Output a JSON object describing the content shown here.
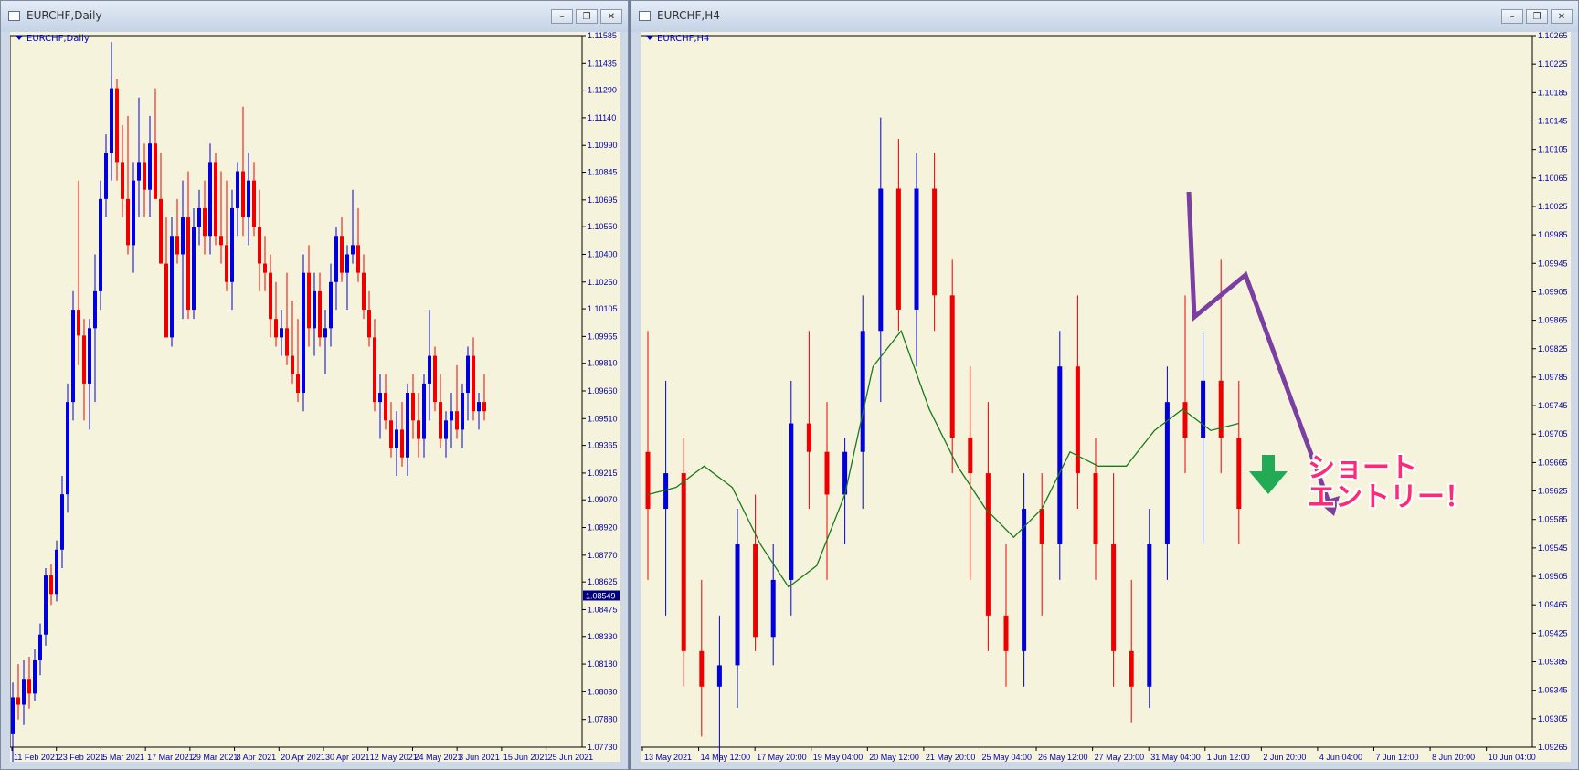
{
  "windows": [
    {
      "title": "EURCHF,Daily",
      "chart_label": "EURCHF,Daily",
      "buttons": [
        "minimize",
        "restore",
        "close"
      ]
    },
    {
      "title": "EURCHF,H4",
      "chart_label": "EURCHF,H4",
      "buttons": [
        "minimize",
        "restore",
        "close"
      ]
    }
  ],
  "annotation": {
    "line1": "ショート",
    "line2": "エントリー！"
  },
  "colors": {
    "bull": "#0000dd",
    "bear": "#ee0000",
    "ma": "#1a7a1a",
    "arrow_purple": "#7a3fa0",
    "arrow_green": "#22aa55",
    "annotation": "#ff2a75"
  },
  "chart_data": [
    {
      "type": "candlestick",
      "symbol": "EURCHF",
      "timeframe": "Daily",
      "y_ticks": [
        "1.11585",
        "1.11435",
        "1.11290",
        "1.11140",
        "1.10990",
        "1.10845",
        "1.10695",
        "1.10550",
        "1.10400",
        "1.10250",
        "1.10105",
        "1.09955",
        "1.09810",
        "1.09660",
        "1.09510",
        "1.09365",
        "1.09215",
        "1.09070",
        "1.08920",
        "1.08770",
        "1.08625",
        "1.08475",
        "1.08330",
        "1.08180",
        "1.08030",
        "1.07880",
        "1.07730"
      ],
      "ylim": [
        1.0773,
        1.11585
      ],
      "current_price": "1.08549",
      "x_labels": [
        "11 Feb 2021",
        "23 Feb 2021",
        "5 Mar 2021",
        "17 Mar 2021",
        "29 Mar 2021",
        "8 Apr 2021",
        "20 Apr 2021",
        "30 Apr 2021",
        "12 May 2021",
        "24 May 2021",
        "3 Jun 2021",
        "15 Jun 2021",
        "25 Jun 2021"
      ],
      "candles": [
        [
          1.078,
          1.0808,
          1.076,
          1.08
        ],
        [
          1.08,
          1.0818,
          1.0788,
          1.0796
        ],
        [
          1.0796,
          1.082,
          1.0785,
          1.081
        ],
        [
          1.081,
          1.0822,
          1.0794,
          1.0802
        ],
        [
          1.0802,
          1.0826,
          1.0798,
          1.082
        ],
        [
          1.082,
          1.084,
          1.0812,
          1.0834
        ],
        [
          1.0834,
          1.087,
          1.0828,
          1.0866
        ],
        [
          1.0866,
          1.0872,
          1.085,
          1.0856
        ],
        [
          1.0856,
          1.0885,
          1.0852,
          1.088
        ],
        [
          1.088,
          1.092,
          1.087,
          1.091
        ],
        [
          1.091,
          1.097,
          1.09,
          1.096
        ],
        [
          1.096,
          1.102,
          1.095,
          1.101
        ],
        [
          1.101,
          1.108,
          1.098,
          1.0996
        ],
        [
          1.0996,
          1.1005,
          1.095,
          1.097
        ],
        [
          1.097,
          1.1005,
          1.0945,
          1.1
        ],
        [
          1.1,
          1.104,
          1.096,
          1.102
        ],
        [
          1.102,
          1.108,
          1.101,
          1.107
        ],
        [
          1.107,
          1.1105,
          1.106,
          1.1095
        ],
        [
          1.1095,
          1.1155,
          1.108,
          1.113
        ],
        [
          1.113,
          1.1135,
          1.108,
          1.109
        ],
        [
          1.109,
          1.111,
          1.106,
          1.107
        ],
        [
          1.107,
          1.1115,
          1.104,
          1.1045
        ],
        [
          1.1045,
          1.109,
          1.103,
          1.108
        ],
        [
          1.108,
          1.1125,
          1.106,
          1.109
        ],
        [
          1.109,
          1.11,
          1.106,
          1.1075
        ],
        [
          1.1075,
          1.1115,
          1.106,
          1.11
        ],
        [
          1.11,
          1.113,
          1.107,
          1.107
        ],
        [
          1.107,
          1.1095,
          1.1035,
          1.1035
        ],
        [
          1.1035,
          1.106,
          1.0995,
          1.0995
        ],
        [
          1.0995,
          1.106,
          1.099,
          1.105
        ],
        [
          1.105,
          1.107,
          1.1035,
          1.104
        ],
        [
          1.104,
          1.108,
          1.1005,
          1.106
        ],
        [
          1.106,
          1.1085,
          1.1005,
          1.101
        ],
        [
          1.101,
          1.1065,
          1.1005,
          1.1055
        ],
        [
          1.1055,
          1.1075,
          1.1045,
          1.1065
        ],
        [
          1.1065,
          1.108,
          1.104,
          1.105
        ],
        [
          1.105,
          1.11,
          1.104,
          1.109
        ],
        [
          1.109,
          1.1095,
          1.1045,
          1.105
        ],
        [
          1.105,
          1.1085,
          1.1035,
          1.1045
        ],
        [
          1.1045,
          1.108,
          1.102,
          1.1025
        ],
        [
          1.1025,
          1.1075,
          1.101,
          1.1065
        ],
        [
          1.1065,
          1.109,
          1.105,
          1.1085
        ],
        [
          1.1085,
          1.112,
          1.105,
          1.106
        ],
        [
          1.106,
          1.1095,
          1.1045,
          1.108
        ],
        [
          1.108,
          1.109,
          1.105,
          1.1055
        ],
        [
          1.1055,
          1.1075,
          1.102,
          1.1035
        ],
        [
          1.1035,
          1.105,
          1.102,
          1.103
        ],
        [
          1.103,
          1.104,
          1.0995,
          1.1005
        ],
        [
          1.1005,
          1.1025,
          1.099,
          1.0995
        ],
        [
          1.0995,
          1.101,
          1.0985,
          1.1
        ],
        [
          1.1,
          1.103,
          1.098,
          1.0985
        ],
        [
          1.0985,
          1.1015,
          1.097,
          1.0975
        ],
        [
          1.0975,
          1.1005,
          1.096,
          1.0965
        ],
        [
          1.0965,
          1.104,
          1.0955,
          1.103
        ],
        [
          1.103,
          1.1045,
          1.099,
          1.1
        ],
        [
          1.1,
          1.103,
          1.0985,
          1.102
        ],
        [
          1.102,
          1.103,
          1.099,
          1.0995
        ],
        [
          1.0995,
          1.101,
          1.0975,
          1.1
        ],
        [
          1.1,
          1.1035,
          1.099,
          1.1025
        ],
        [
          1.1025,
          1.1055,
          1.101,
          1.105
        ],
        [
          1.105,
          1.106,
          1.1025,
          1.103
        ],
        [
          1.103,
          1.1045,
          1.101,
          1.104
        ],
        [
          1.104,
          1.1075,
          1.1035,
          1.1045
        ],
        [
          1.1045,
          1.1065,
          1.1025,
          1.103
        ],
        [
          1.103,
          1.104,
          1.1005,
          1.101
        ],
        [
          1.101,
          1.102,
          1.099,
          1.0995
        ],
        [
          1.0995,
          1.1005,
          1.0955,
          1.096
        ],
        [
          1.096,
          1.0975,
          1.094,
          1.0965
        ],
        [
          1.0965,
          1.0975,
          1.0945,
          1.095
        ],
        [
          1.095,
          1.096,
          1.093,
          1.0935
        ],
        [
          1.0935,
          1.0955,
          1.092,
          1.0945
        ],
        [
          1.0945,
          1.096,
          1.0925,
          1.093
        ],
        [
          1.093,
          1.097,
          1.092,
          1.0965
        ],
        [
          1.0965,
          1.0975,
          1.094,
          1.095
        ],
        [
          1.095,
          1.0965,
          1.093,
          1.094
        ],
        [
          1.094,
          1.0975,
          1.093,
          1.097
        ],
        [
          1.097,
          1.101,
          1.095,
          1.0985
        ],
        [
          1.0985,
          1.099,
          1.0955,
          1.096
        ],
        [
          1.096,
          1.0975,
          1.0935,
          1.094
        ],
        [
          1.094,
          1.0955,
          1.093,
          1.095
        ],
        [
          1.095,
          1.0965,
          1.0935,
          1.0955
        ],
        [
          1.0955,
          1.098,
          1.094,
          1.0945
        ],
        [
          1.0945,
          1.097,
          1.0935,
          1.0965
        ],
        [
          1.0965,
          1.099,
          1.095,
          1.0985
        ],
        [
          1.0985,
          1.0995,
          1.095,
          1.0955
        ],
        [
          1.0955,
          1.0965,
          1.0945,
          1.096
        ],
        [
          1.096,
          1.0975,
          1.095,
          1.0955
        ]
      ]
    },
    {
      "type": "candlestick",
      "symbol": "EURCHF",
      "timeframe": "H4",
      "y_ticks": [
        "1.10265",
        "1.10225",
        "1.10185",
        "1.10145",
        "1.10105",
        "1.10065",
        "1.10025",
        "1.09985",
        "1.09945",
        "1.09905",
        "1.09865",
        "1.09825",
        "1.09785",
        "1.09745",
        "1.09705",
        "1.09665",
        "1.09625",
        "1.09585",
        "1.09545",
        "1.09505",
        "1.09465",
        "1.09425",
        "1.09385",
        "1.09345",
        "1.09305",
        "1.09265"
      ],
      "ylim": [
        1.09265,
        1.10265
      ],
      "x_labels": [
        "13 May 2021",
        "14 May 12:00",
        "17 May 20:00",
        "19 May 04:00",
        "20 May 12:00",
        "21 May 20:00",
        "25 May 04:00",
        "26 May 12:00",
        "27 May 20:00",
        "31 May 04:00",
        "1 Jun 12:00",
        "2 Jun 20:00",
        "4 Jun 04:00",
        "7 Jun 12:00",
        "8 Jun 20:00",
        "10 Jun 04:00"
      ],
      "moving_average": [
        1.0962,
        1.0963,
        1.0966,
        1.0963,
        1.0955,
        1.0949,
        1.0952,
        1.0962,
        1.098,
        1.0985,
        1.0974,
        1.0966,
        1.096,
        1.0956,
        1.096,
        1.0968,
        1.0966,
        1.0966,
        1.0971,
        1.0974,
        1.0971,
        1.0972
      ],
      "candles": [
        [
          1.0968,
          1.0985,
          1.095,
          1.096
        ],
        [
          1.096,
          1.0978,
          1.0945,
          1.0965
        ],
        [
          1.0965,
          1.097,
          1.0935,
          1.094
        ],
        [
          1.094,
          1.095,
          1.0928,
          1.0935
        ],
        [
          1.0935,
          1.0945,
          1.092,
          1.0938
        ],
        [
          1.0938,
          1.096,
          1.0932,
          1.0955
        ],
        [
          1.0955,
          1.0962,
          1.094,
          1.0942
        ],
        [
          1.0942,
          1.0955,
          1.0938,
          1.095
        ],
        [
          1.095,
          1.0978,
          1.0945,
          1.0972
        ],
        [
          1.0972,
          1.0985,
          1.096,
          1.0968
        ],
        [
          1.0968,
          1.0975,
          1.095,
          1.0962
        ],
        [
          1.0962,
          1.097,
          1.0955,
          1.0968
        ],
        [
          1.0968,
          1.099,
          1.096,
          1.0985
        ],
        [
          1.0985,
          1.1015,
          1.0975,
          1.1005
        ],
        [
          1.1005,
          1.1012,
          1.0985,
          1.0988
        ],
        [
          1.0988,
          1.101,
          1.098,
          1.1005
        ],
        [
          1.1005,
          1.101,
          1.0985,
          1.099
        ],
        [
          1.099,
          1.0995,
          1.0965,
          1.097
        ],
        [
          1.097,
          1.098,
          1.095,
          1.0965
        ],
        [
          1.0965,
          1.0975,
          1.094,
          1.0945
        ],
        [
          1.0945,
          1.0955,
          1.0935,
          1.094
        ],
        [
          1.094,
          1.0965,
          1.0935,
          1.096
        ],
        [
          1.096,
          1.0965,
          1.0945,
          1.0955
        ],
        [
          1.0955,
          1.0985,
          1.095,
          1.098
        ],
        [
          1.098,
          1.099,
          1.096,
          1.0965
        ],
        [
          1.0965,
          1.097,
          1.095,
          1.0955
        ],
        [
          1.0955,
          1.0965,
          1.0935,
          1.094
        ],
        [
          1.094,
          1.095,
          1.093,
          1.0935
        ],
        [
          1.0935,
          1.096,
          1.0932,
          1.0955
        ],
        [
          1.0955,
          1.098,
          1.095,
          1.0975
        ],
        [
          1.0975,
          1.099,
          1.0965,
          1.097
        ],
        [
          1.097,
          1.0985,
          1.0955,
          1.0978
        ],
        [
          1.0978,
          1.0995,
          1.0965,
          1.097
        ],
        [
          1.097,
          1.0978,
          1.0955,
          1.096
        ]
      ]
    }
  ]
}
